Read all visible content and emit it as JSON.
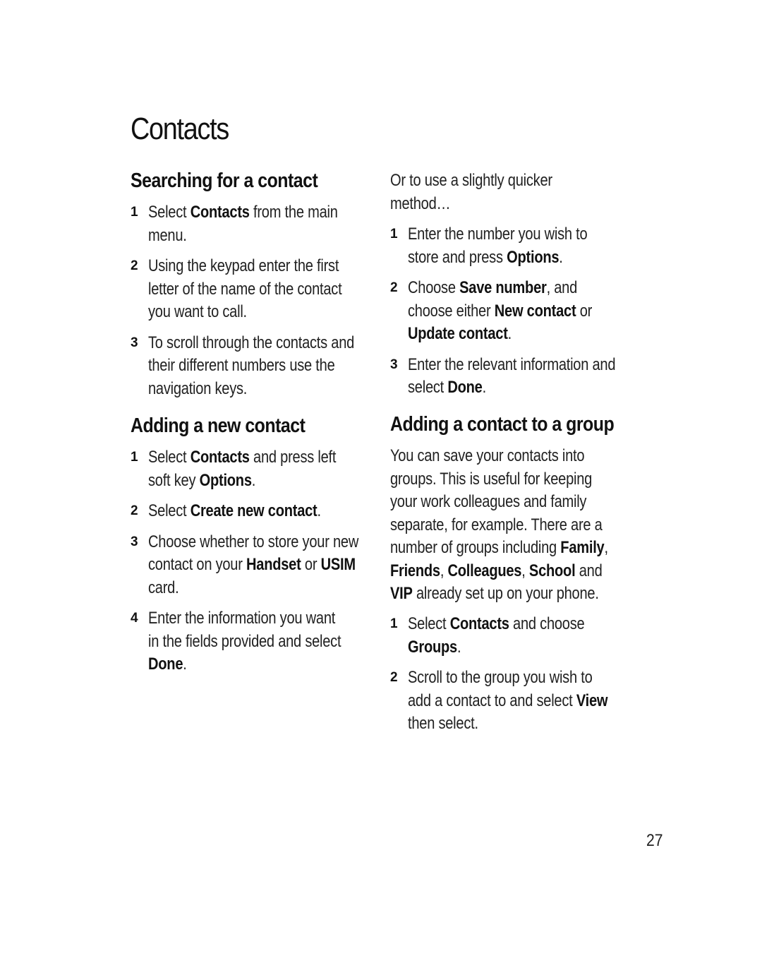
{
  "page": {
    "title": "Contacts",
    "page_number": "27"
  },
  "left_column": {
    "searching": {
      "heading": "Searching for a contact",
      "steps": [
        {
          "num": "1",
          "lines": [
            [
              "Select ",
              "**Contacts",
              " from the main"
            ],
            [
              "menu."
            ]
          ]
        },
        {
          "num": "2",
          "lines": [
            [
              "Using the keypad enter the first"
            ],
            [
              "letter of the name of the contact"
            ],
            [
              "you want to call."
            ]
          ]
        },
        {
          "num": "3",
          "lines": [
            [
              "To scroll through the contacts and"
            ],
            [
              "their different numbers use the"
            ],
            [
              "navigation keys."
            ]
          ]
        }
      ]
    },
    "adding_new": {
      "heading": "Adding a new contact",
      "steps": [
        {
          "num": "1",
          "lines": [
            [
              "Select ",
              "**Contacts",
              " and press left"
            ],
            [
              "soft key ",
              "**Options",
              "."
            ]
          ]
        },
        {
          "num": "2",
          "lines": [
            [
              "Select ",
              "**Create new contact",
              "."
            ]
          ]
        },
        {
          "num": "3",
          "lines": [
            [
              "Choose whether to store your new"
            ],
            [
              "contact on your ",
              "**Handset",
              " or ",
              "**USIM"
            ],
            [
              "card."
            ]
          ]
        },
        {
          "num": "4",
          "lines": [
            [
              "Enter the information you want"
            ],
            [
              "in the fields provided and select"
            ],
            [
              "**Done",
              "."
            ]
          ]
        }
      ]
    }
  },
  "right_column": {
    "quicker_method": {
      "intro_lines": [
        "Or to use a slightly quicker",
        "method…"
      ],
      "steps": [
        {
          "num": "1",
          "lines": [
            [
              "Enter the number you wish to"
            ],
            [
              "store and press ",
              "**Options",
              "."
            ]
          ]
        },
        {
          "num": "2",
          "lines": [
            [
              "Choose ",
              "**Save number",
              ", and"
            ],
            [
              "choose either ",
              "**New contact",
              " or"
            ],
            [
              "**Update contact",
              "."
            ]
          ]
        },
        {
          "num": "3",
          "lines": [
            [
              "Enter the relevant information and"
            ],
            [
              "select ",
              "**Done",
              "."
            ]
          ]
        }
      ]
    },
    "adding_to_group": {
      "heading": "Adding a contact to a group",
      "paragraph_lines": [
        [
          "You can save your contacts into"
        ],
        [
          "groups. This is useful for keeping"
        ],
        [
          "your work colleagues and family"
        ],
        [
          "separate, for example. There are a"
        ],
        [
          "number of groups including ",
          "**Family",
          ","
        ],
        [
          "**Friends",
          ", ",
          "**Colleagues",
          ", ",
          "**School",
          " and"
        ],
        [
          "**VIP",
          " already set up on your phone."
        ]
      ],
      "steps": [
        {
          "num": "1",
          "lines": [
            [
              "Select ",
              "**Contacts",
              " and choose"
            ],
            [
              "**Groups",
              "."
            ]
          ]
        },
        {
          "num": "2",
          "lines": [
            [
              "Scroll to the group you wish to"
            ],
            [
              "add a contact to and select ",
              "**View"
            ],
            [
              "then select."
            ]
          ]
        }
      ]
    }
  }
}
